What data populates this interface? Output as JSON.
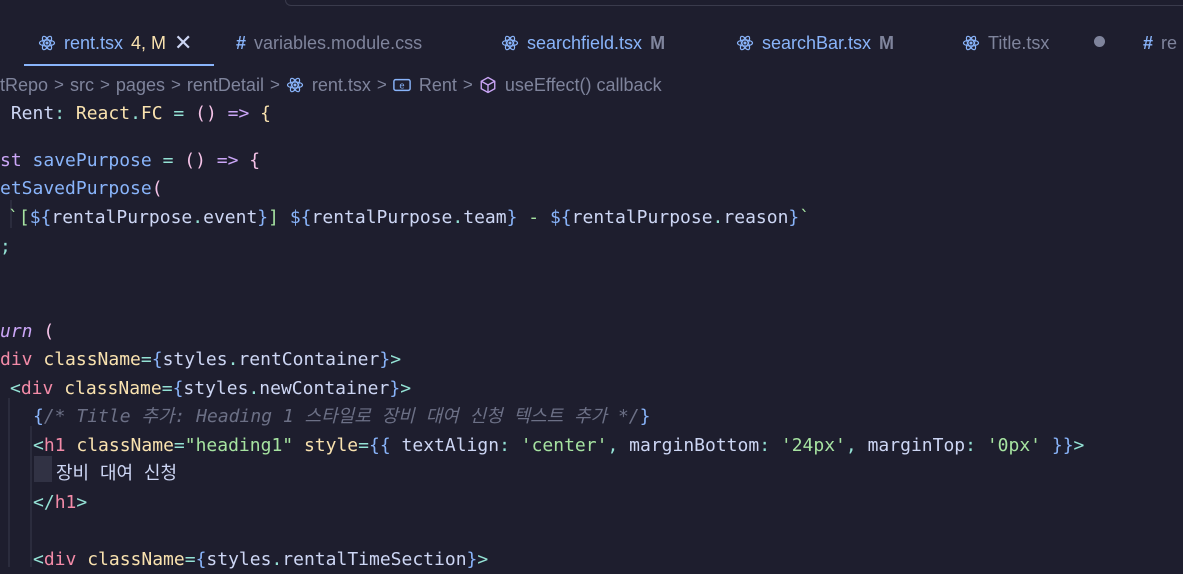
{
  "tabs": [
    {
      "name": "rent.tsx",
      "status": "4, M",
      "icon": "react-icon",
      "active": true
    },
    {
      "name": "variables.module.css",
      "status": "",
      "icon": "css-hash-icon"
    },
    {
      "name": "searchfield.tsx",
      "status": "M",
      "icon": "react-icon"
    },
    {
      "name": "searchBar.tsx",
      "status": "M",
      "icon": "react-icon"
    },
    {
      "name": "Title.tsx",
      "status": "",
      "icon": "react-icon"
    },
    {
      "name": "re",
      "status": "",
      "icon": "css-hash-icon"
    }
  ],
  "breadcrumb": {
    "repo": "tRepo",
    "src": "src",
    "pages": "pages",
    "folder": "rentDetail",
    "file": "rent.tsx",
    "symbol": "Rent",
    "callback": "useEffect() callback"
  },
  "code": {
    "l1": {
      "a": " Rent",
      "b": ": ",
      "c": "React",
      "d": ".",
      "e": "FC",
      "f": " = ",
      "g": "()",
      "h": " => ",
      "i": "{"
    },
    "l2": {
      "a": "st ",
      "b": "savePurpose",
      "c": " = ",
      "d": "()",
      "e": " => ",
      "f": "{"
    },
    "l3": {
      "a": "etSavedPurpose",
      "b": "("
    },
    "l4": {
      "a": "`[",
      "b": "${",
      "c": "rentalPurpose",
      "d": ".",
      "e": "event",
      "f": "}",
      "g": "] ",
      "h": "${",
      "i": "rentalPurpose",
      "j": ".",
      "k": "team",
      "l": "}",
      "m": " - ",
      "n": "${",
      "o": "rentalPurpose",
      "p": ".",
      "q": "reason",
      "r": "}",
      "s": "`"
    },
    "l5": {
      "a": ";"
    },
    "l6": {
      "a": "urn",
      "b": " ("
    },
    "l7": {
      "a": "div",
      "b": " className",
      "c": "=",
      "d": "{",
      "e": "styles",
      "f": ".",
      "g": "rentContainer",
      "h": "}",
      "i": ">"
    },
    "l8": {
      "a": "<",
      "b": "div",
      "c": " className",
      "d": "=",
      "e": "{",
      "f": "styles",
      "g": ".",
      "h": "newContainer",
      "i": "}",
      "j": ">"
    },
    "l9": {
      "a": "{",
      "b": "/* Title 추가: Heading 1 스타일로 장비 대여 신청 텍스트 추가 */",
      "c": "}"
    },
    "l10": {
      "a": "<",
      "b": "h1",
      "c": " className",
      "d": "=",
      "e": "\"heading1\"",
      "f": " style",
      "g": "=",
      "h": "{{",
      "i": " textAlign",
      "j": ": ",
      "k": "'center'",
      "l": ", ",
      "m": "marginBottom",
      "n": ": ",
      "o": "'24px'",
      "p": ", ",
      "q": "marginTop",
      "r": ": ",
      "s": "'0px'",
      "t": " ",
      "u": "}}",
      "v": ">"
    },
    "l11": {
      "a": "장비 대여 신청"
    },
    "l12": {
      "a": "</",
      "b": "h1",
      "c": ">"
    },
    "l13": {
      "a": "<",
      "b": "div",
      "c": " className",
      "d": "=",
      "e": "{",
      "f": "styles",
      "g": ".",
      "h": "rentalTimeSection",
      "i": "}",
      "j": ">"
    }
  },
  "colors": {
    "background": "#1e1e2e",
    "accent": "#89b4fa",
    "modified": "#f9e2af",
    "keyword": "#cba6f7",
    "string": "#a6e3a1",
    "tag": "#f38ba8",
    "comment": "#6c7086"
  }
}
